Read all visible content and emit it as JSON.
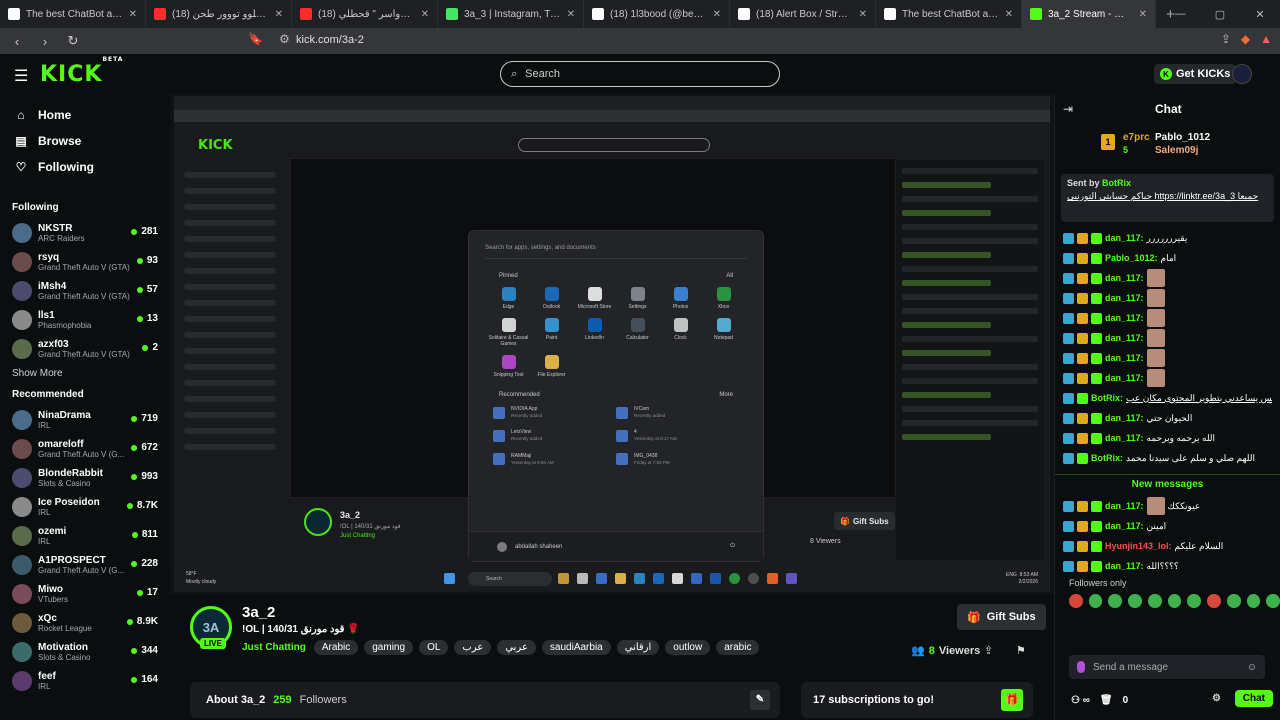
{
  "browser": {
    "tabs": [
      {
        "label": "The best ChatBot and Widgets",
        "color": "#ffffff"
      },
      {
        "label": "طحن 14 | اكسبلوو تووور طحن (18)",
        "color": "#ff2a2a"
      },
      {
        "label": "(18) شيلة الدواسر \" قحطلي ||",
        "color": "#ff2a2a"
      },
      {
        "label": "3a_3 | Instagram, TikTok | Linkt",
        "color": "#43e660"
      },
      {
        "label": "(18) 1l3bood (@be5lll) / X",
        "color": "#ffffff"
      },
      {
        "label": "(18) Alert Box / Streamlabs",
        "color": "#ffffff"
      },
      {
        "label": "The best ChatBot and Widgets",
        "color": "#ffffff"
      },
      {
        "label": "3a_2 Stream - Watch Live",
        "color": "#53fc18"
      }
    ],
    "url": "kick.com/3a-2"
  },
  "header": {
    "logo": "KICK",
    "logo_sup": "BETA",
    "search_placeholder": "Search",
    "get_kicks": "Get KICKs"
  },
  "sidebar": {
    "nav": [
      {
        "label": "Home",
        "icon": "home-icon"
      },
      {
        "label": "Browse",
        "icon": "browse-icon"
      },
      {
        "label": "Following",
        "icon": "heart-icon"
      }
    ],
    "following_title": "Following",
    "following": [
      {
        "name": "NKSTR",
        "category": "ARC Raiders",
        "viewers": "281"
      },
      {
        "name": "rsyq",
        "category": "Grand Theft Auto V (GTA)",
        "viewers": "93"
      },
      {
        "name": "iMsh4",
        "category": "Grand Theft Auto V (GTA)",
        "viewers": "57"
      },
      {
        "name": "lls1",
        "category": "Phasmophobia",
        "viewers": "13"
      },
      {
        "name": "azxf03",
        "category": "Grand Theft Auto V (GTA)",
        "viewers": "2"
      }
    ],
    "show_more": "Show More",
    "recommended_title": "Recommended",
    "recommended": [
      {
        "name": "NinaDrama",
        "category": "IRL",
        "viewers": "719"
      },
      {
        "name": "omareloff",
        "category": "Grand Theft Auto V (G...",
        "viewers": "672"
      },
      {
        "name": "BlondeRabbit",
        "category": "Slots & Casino",
        "viewers": "993"
      },
      {
        "name": "Ice Poseidon",
        "category": "IRL",
        "viewers": "8.7K"
      },
      {
        "name": "ozemi",
        "category": "IRL",
        "viewers": "811"
      },
      {
        "name": "A1PROSPECT",
        "category": "Grand Theft Auto V (G...",
        "viewers": "228"
      },
      {
        "name": "Miwo",
        "category": "VTubers",
        "viewers": "17"
      },
      {
        "name": "xQc",
        "category": "Rocket League",
        "viewers": "8.9K"
      },
      {
        "name": "Motivation",
        "category": "Slots & Casino",
        "viewers": "344"
      },
      {
        "name": "feef",
        "category": "IRL",
        "viewers": "164"
      }
    ]
  },
  "startmenu": {
    "search": "Search for apps, settings, and documents",
    "pinned": "Pinned",
    "all": "All",
    "apps": [
      {
        "label": "Edge",
        "color": "#2b8fd6"
      },
      {
        "label": "Outlook",
        "color": "#1a73c8"
      },
      {
        "label": "Microsoft Store",
        "color": "#f3f3f3"
      },
      {
        "label": "Settings",
        "color": "#8a8f98"
      },
      {
        "label": "Photos",
        "color": "#3c8ce7"
      },
      {
        "label": "Xbox",
        "color": "#2ea043"
      },
      {
        "label": "Solitaire & Casual Games",
        "color": "#e8e8e8"
      },
      {
        "label": "Paint",
        "color": "#39a0e0"
      },
      {
        "label": "LinkedIn",
        "color": "#0a66c2"
      },
      {
        "label": "Calculator",
        "color": "#4b5563"
      },
      {
        "label": "Clock",
        "color": "#d4d4d4"
      },
      {
        "label": "Notepad",
        "color": "#5bbbe8"
      },
      {
        "label": "Snipping Tool",
        "color": "#c04bd6"
      },
      {
        "label": "File Explorer",
        "color": "#f2c14e"
      }
    ],
    "recommended": "Recommended",
    "more": "More",
    "items": [
      {
        "title": "NVIDIA App",
        "sub": "Recently added"
      },
      {
        "title": "iVCam",
        "sub": "Recently added"
      },
      {
        "title": "LetsView",
        "sub": "Recently added"
      },
      {
        "title": "4",
        "sub": "Yesterday at 8:17 AM"
      },
      {
        "title": "RAMMaji",
        "sub": "Yesterday at 8:56 AM"
      },
      {
        "title": "IMG_0438",
        "sub": "Friday at 7:50 PM"
      }
    ],
    "user": "abdallah shaheen"
  },
  "taskbar": {
    "weather_temp": "58°F",
    "weather": "Mostly cloudy",
    "search": "Search",
    "lang": "ENG",
    "time": "8:53 AM",
    "date": "2/2/2026"
  },
  "nested_info": {
    "name": "3a_2",
    "title": "!OL | 140/31 قود مورنق",
    "category": "Just Chatting",
    "gift": "Gift Subs",
    "viewers": "8 Viewers"
  },
  "stream": {
    "avatar_text": "3A",
    "live": "LIVE",
    "name": "3a_2",
    "title": "!OL | 140/31 قود مورنق 🌹",
    "category": "Just Chatting",
    "tags": [
      "Arabic",
      "gaming",
      "OL",
      "عرب",
      "عربي",
      "saudiAarbia",
      "ارقاني",
      "outlow",
      "arabic"
    ],
    "gift_subs": "Gift Subs",
    "viewers_count": "8",
    "viewers_label": "Viewers",
    "about": "About 3a_2",
    "followers_count": "259",
    "followers_label": "Followers",
    "subs_goal": "17 subscriptions to go!"
  },
  "chat": {
    "title": "Chat",
    "leader_badge": "1",
    "leader_user": "e7prc",
    "leader_count": "5",
    "top_user2": "Pablo_1012",
    "top_user3": "Salem09j",
    "pin_by_prefix": "Sent by",
    "pin_by_user": "BotRix",
    "pin_text": "حياكم حسابتي التورنيي https://linktr.ee/3a_3 جميعا",
    "messages": [
      {
        "user": "dan_117:",
        "text": "يقيررررررر",
        "emote": false
      },
      {
        "user": "Pablo_1012:",
        "text": "امام",
        "emote": false
      },
      {
        "user": "dan_117:",
        "text": "",
        "emote": true
      },
      {
        "user": "dan_117:",
        "text": "",
        "emote": true
      },
      {
        "user": "dan_117:",
        "text": "",
        "emote": true
      },
      {
        "user": "dan_117:",
        "text": "",
        "emote": true
      },
      {
        "user": "dan_117:",
        "text": "",
        "emote": true
      },
      {
        "user": "dan_117:",
        "text": "",
        "emote": true
      },
      {
        "user": "BotRix:",
        "text": "الدعم من اجباري بس يساعدني بتطوير المحتوى مكان عب https://tip.dokan.sa/1l3bood",
        "emote": false
      },
      {
        "user": "dan_117:",
        "text": "الحيوان حتي",
        "emote": false
      },
      {
        "user": "dan_117:",
        "text": "الله يرحمه ويرحمه",
        "emote": false
      },
      {
        "user": "BotRix:",
        "text": "اللهم صلي و سلم على سيدنا محمد",
        "emote": false
      }
    ],
    "new_messages": "New messages",
    "messages2": [
      {
        "user": "dan_117:",
        "text": "عيونككك",
        "emote": true
      },
      {
        "user": "dan_117:",
        "text": "امينن",
        "emote": false
      },
      {
        "user": "Hyunjin143_lol:",
        "text": "السلام عليكم",
        "emote": false
      },
      {
        "user": "dan_117:",
        "text": "؟؟؟؟الله",
        "emote": false
      }
    ],
    "followers_only": "Followers only",
    "send_placeholder": "Send a message",
    "kicks": "0",
    "chat_button": "Chat"
  }
}
